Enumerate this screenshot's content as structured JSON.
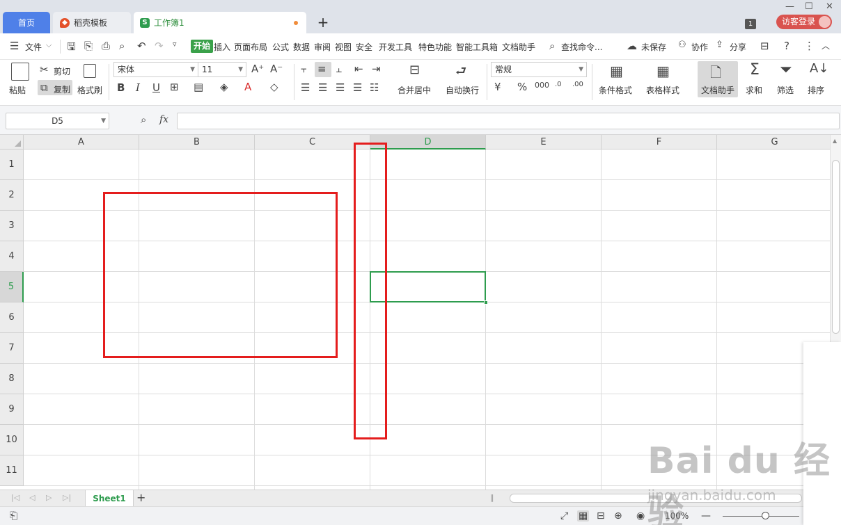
{
  "tabs": {
    "home": "首页",
    "template": "稻壳模板",
    "workbook": "工作簿1",
    "add": "+"
  },
  "window": {
    "badge": "1",
    "login": "访客登录",
    "minimize": "—",
    "maximize": "☐",
    "close": "✕"
  },
  "menubar": {
    "file": "文件",
    "start": "开始",
    "items": [
      "插入",
      "页面布局",
      "公式",
      "数据",
      "审阅",
      "视图",
      "安全",
      "开发工具",
      "特色功能",
      "智能工具箱",
      "文档助手"
    ],
    "search": "查找命令...",
    "unsaved": "未保存",
    "collab": "协作",
    "share": "分享"
  },
  "ribbon": {
    "paste": "粘贴",
    "cut": "剪切",
    "copy": "复制",
    "format_painter": "格式刷",
    "font_name": "宋体",
    "font_size": "11",
    "number_format": "常规",
    "merge_center": "合并居中",
    "wrap_text": "自动换行",
    "conditional_format": "条件格式",
    "table_style": "表格样式",
    "doc_assistant": "文档助手",
    "sum": "求和",
    "filter": "筛选",
    "sort": "排序"
  },
  "formula_bar": {
    "name_box": "D5",
    "fx": "fx",
    "value": ""
  },
  "grid": {
    "columns": [
      "A",
      "B",
      "C",
      "D",
      "E",
      "F",
      "G"
    ],
    "rows": [
      "1",
      "2",
      "3",
      "4",
      "5",
      "6",
      "7",
      "8",
      "9",
      "10",
      "11"
    ],
    "active_column": "D",
    "active_row": "5"
  },
  "sheets": {
    "names": [
      "Sheet1"
    ],
    "add": "+"
  },
  "status": {
    "zoom": "100%"
  },
  "watermark": {
    "logo": "Bai du 经验",
    "url": "jingyan.baidu.com"
  },
  "colors": {
    "accent_green": "#2e9c4e",
    "tab_blue": "#4f80e8",
    "annotation_red": "#e41d1d",
    "login_red": "#d9534f"
  }
}
